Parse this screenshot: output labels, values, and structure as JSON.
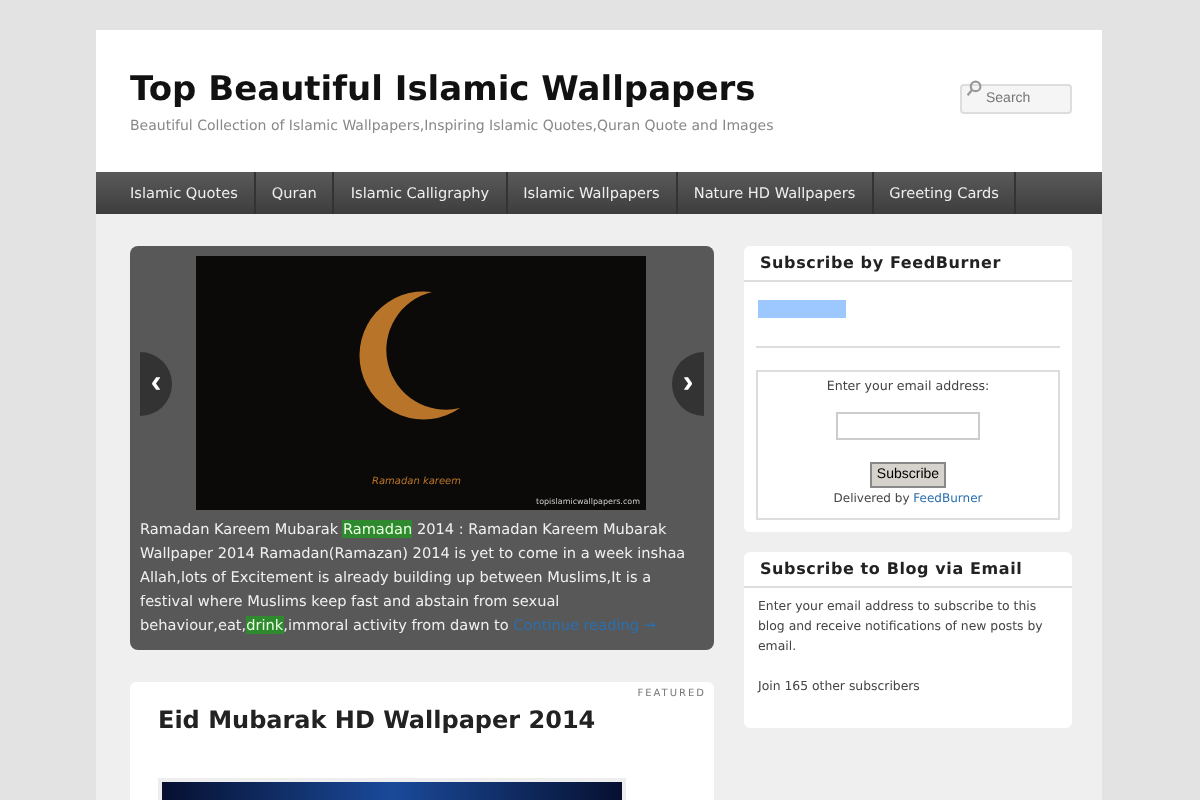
{
  "site": {
    "title": "Top Beautiful Islamic Wallpapers",
    "tagline": "Beautiful Collection of Islamic Wallpapers,Inspiring Islamic Quotes,Quran Quote and Images"
  },
  "search": {
    "placeholder": "Search"
  },
  "nav": [
    "Islamic Quotes",
    "Quran",
    "Islamic Calligraphy",
    "Islamic Wallpapers",
    "Nature HD Wallpapers",
    "Greeting Cards"
  ],
  "slider": {
    "prev": "‹",
    "next": "›",
    "image_credit": "topislamicwallpapers.com",
    "image_caption": "Ramadan kareem",
    "excerpt": [
      {
        "kind": "text",
        "text": "Ramadan Kareem Mubarak "
      },
      {
        "kind": "tag",
        "text": "Ramadan"
      },
      {
        "kind": "text",
        "text": " 2014 : Ramadan Kareem Mubarak Wallpaper 2014 Ramadan(Ramazan) 2014 is yet to come in a week inshaa Allah,lots of Excitement is already building up between Muslims,It is a festival where Muslims keep fast and abstain from sexual behaviour,eat,"
      },
      {
        "kind": "tag",
        "text": "drink"
      },
      {
        "kind": "text",
        "text": ",immoral activity from dawn to "
      },
      {
        "kind": "link",
        "text": "Continue reading →"
      }
    ]
  },
  "widgets": [
    {
      "title": "Subscribe by FeedBurner",
      "prompt": "Enter your email address:",
      "button": "Subscribe",
      "delivered": "Delivered by ",
      "delivered_link": "FeedBurner"
    },
    {
      "title": "Subscribe to Blog via Email",
      "text": "Enter your email address to subscribe to this blog and receive notifications of new posts by email.",
      "subscribers": "Join 165 other subscribers"
    }
  ],
  "post": {
    "badge": "FEATURED",
    "title": "Eid Mubarak HD Wallpaper 2014"
  }
}
